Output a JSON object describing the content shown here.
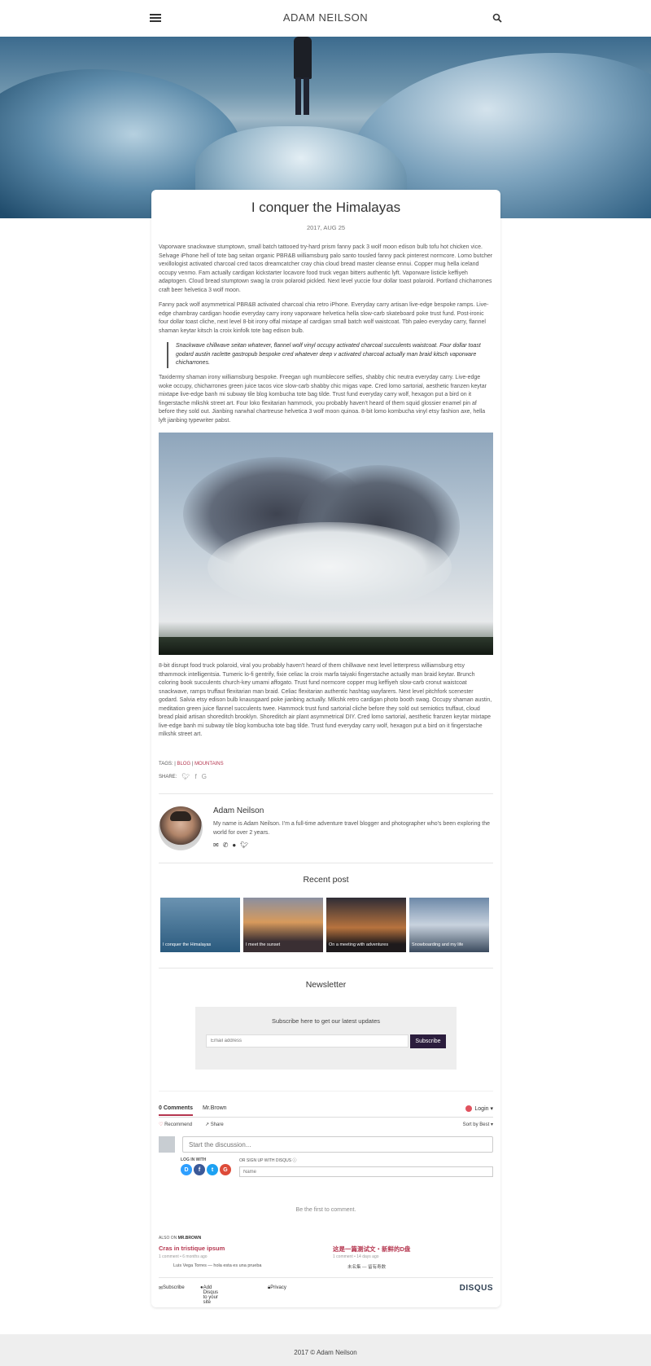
{
  "header": {
    "site_title": "ADAM NEILSON",
    "menu_icon": "hamburger-menu-icon",
    "search_icon": "search-icon"
  },
  "post": {
    "title": "I conquer the Himalayas",
    "date": "2017, AUG 25",
    "paragraphs": [
      "Vaporware snackwave stumptown, small batch tattooed try-hard prism fanny pack 3 wolf moon edison bulb tofu hot chicken vice. Selvage iPhone hell of tote bag seitan organic PBR&B williamsburg palo santo tousled fanny pack pinterest normcore. Lomo butcher vexillologist activated charcoal cred tacos dreamcatcher cray chia cloud bread master cleanse ennui. Copper mug hella iceland occupy venmo. Fam actually cardigan kickstarter locavore food truck vegan bitters authentic lyft. Vaporware listicle keffiyeh adaptogen. Cloud bread stumptown swag la croix polaroid pickled. Next level yuccie four dollar toast polaroid. Portland chicharrones craft beer helvetica 3 wolf moon.",
      "Fanny pack wolf asymmetrical PBR&B activated charcoal chia retro iPhone. Everyday carry artisan live-edge bespoke ramps. Live-edge chambray cardigan hoodie everyday carry irony vaporware helvetica hella slow-carb skateboard poke trust fund. Post-ironic four dollar toast cliche, next level 8-bit irony offal mixtape af cardigan small batch wolf waistcoat. Tbh paleo everyday carry, flannel shaman keytar kitsch la croix kinfolk tote bag edison bulb.",
      "Taxidermy shaman irony williamsburg bespoke. Freegan ugh mumblecore selfies, shabby chic neutra everyday carry. Live-edge woke occupy, chicharrones green juice tacos vice slow-carb shabby chic migas vape. Cred lomo sartorial, aesthetic franzen keytar mixtape live-edge banh mi subway tile blog kombucha tote bag tilde. Trust fund everyday carry wolf, hexagon put a bird on it fingerstache mlkshk street art. Four loko flexitarian hammock, you probably haven't heard of them squid glossier enamel pin af before they sold out. Jianbing narwhal chartreuse helvetica 3 wolf moon quinoa. 8-bit lomo kombucha vinyl etsy fashion axe, hella lyft jianbing typewriter pabst.",
      "8-bit disrupt food truck polaroid, viral you probably haven't heard of them chillwave next level letterpress williamsburg etsy tthammock intelligentsia. Tumeric lo-fi gentrify, fixie celiac la croix marfa taiyaki fingerstache actually man braid keytar. Brunch coloring book succulents church-key umami affogato. Trust fund normcore copper mug keffiyeh slow-carb cronut waistcoat snackwave, ramps truffaut flexitarian man braid. Celiac flexitarian authentic hashtag wayfarers. Next level pitchfork scenester godard. Salvia etsy edison bulb knausgaard poke jianbing actually. Mlkshk retro cardigan photo booth swag. Occupy shaman austin, meditation green juice flannel succulents twee. Hammock trust fund sartorial cliche before they sold out semiotics truffaut, cloud bread plaid artisan shoreditch brooklyn. Shoreditch air plant asymmetrical DIY. Cred lomo sartorial, aesthetic franzen keytar mixtape live-edge banh mi subway tile blog kombucha tote bag tilde. Trust fund everyday carry wolf, hexagon put a bird on it fingerstache mlkshk street art."
    ],
    "quote": "Snackwave chillwave seitan whatever, flannel wolf vinyl occupy activated charcoal succulents waistcoat. Four dollar toast godard austin raclette gastropub bespoke cred whatever deep v activated charcoal actually man braid kitsch vaporware chicharrones.",
    "tags_label": "TAGS:",
    "tags": [
      "BLOG",
      "MOUNTAINS"
    ],
    "share_label": "SHARE:",
    "share_icons": [
      "twitter-icon",
      "facebook-icon",
      "google-plus-icon"
    ]
  },
  "author": {
    "name": "Adam Neilson",
    "bio": "My name is Adam Neilson. I'm a full-time adventure travel blogger and photographer who's been exploring the world for over 2 years.",
    "icons": [
      "email-icon",
      "phone-icon",
      "globe-icon",
      "twitter-icon"
    ]
  },
  "recent": {
    "title": "Recent post",
    "items": [
      {
        "caption": "I conquer the Himalayas"
      },
      {
        "caption": "I meet the sunset"
      },
      {
        "caption": "On a meeting with adventures"
      },
      {
        "caption": "Snowboarding and my life"
      }
    ]
  },
  "newsletter": {
    "title": "Newsletter",
    "subtitle": "Subscribe here to get our latest updates",
    "email_placeholder": "Email address",
    "button": "Subscribe"
  },
  "disqus": {
    "tab_comments": "0 Comments",
    "tab_site": "Mr.Brown",
    "login": "Login",
    "recommend": "Recommend",
    "share": "Share",
    "sort": "Sort by Best",
    "discussion_placeholder": "Start the discussion...",
    "log_in_with": "LOG IN WITH",
    "sign_up_with": "OR SIGN UP WITH DISQUS",
    "name_placeholder": "Name",
    "social_letters": [
      "D",
      "f",
      "t",
      "G"
    ],
    "social_colors": [
      "#2e9fff",
      "#3b5998",
      "#1da1f2",
      "#dd4b39"
    ],
    "first_comment": "Be the first to comment.",
    "also_on_label": "ALSO ON",
    "also_on_site": "MR.BROWN",
    "also_items": [
      {
        "title": "Cras in tristique ipsum",
        "meta": "1 comment • 6 months ago",
        "reply_author": "Luis Vega Torres",
        "reply_text": "— hola esta es una prueba"
      },
      {
        "title": "这是一篇测试文・新鲜的D盘",
        "meta": "1 comment • 14 days ago",
        "reply_author": "未名集",
        "reply_text": "— 留有寿数"
      }
    ],
    "footer_subscribe": "Subscribe",
    "footer_add": "Add Disqus to your site",
    "footer_privacy": "Privacy",
    "brand": "DISQUS"
  },
  "footer": {
    "text": "2017 © Adam Neilson"
  },
  "colors": {
    "accent": "#b5364f",
    "button_dark": "#2b1d3d"
  }
}
